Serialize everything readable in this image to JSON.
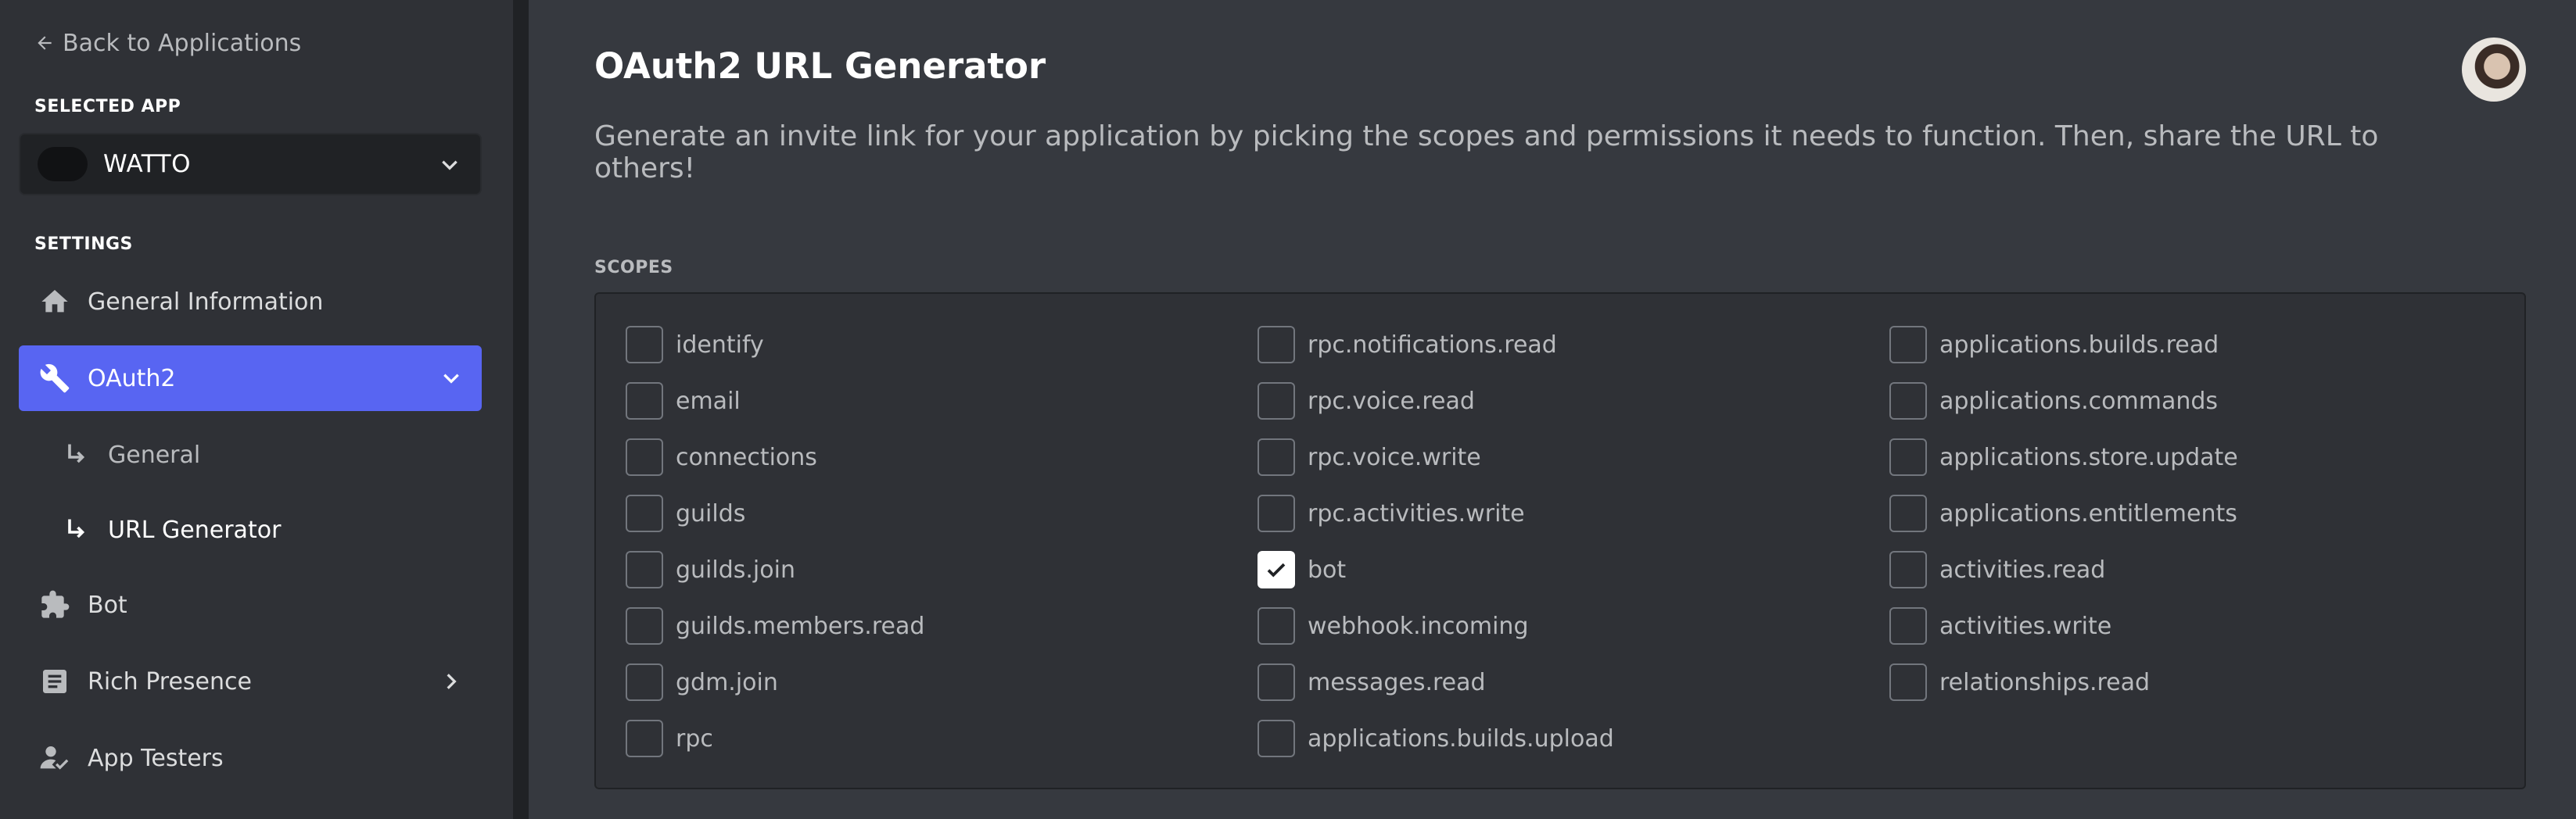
{
  "sidebar": {
    "back_label": "Back to Applications",
    "selected_app_heading": "SELECTED APP",
    "app_name": "WATTO",
    "settings_heading": "SETTINGS",
    "items": {
      "general_information": "General Information",
      "oauth2": "OAuth2",
      "oauth2_general": "General",
      "oauth2_url_generator": "URL Generator",
      "bot": "Bot",
      "rich_presence": "Rich Presence",
      "app_testers": "App Testers"
    },
    "accent_color": "#5865f2"
  },
  "main": {
    "title": "OAuth2 URL Generator",
    "description": "Generate an invite link for your application by picking the scopes and permissions it needs to function. Then, share the URL to others!",
    "scopes_heading": "SCOPES",
    "scopes": {
      "col1": [
        {
          "label": "identify",
          "checked": false
        },
        {
          "label": "email",
          "checked": false
        },
        {
          "label": "connections",
          "checked": false
        },
        {
          "label": "guilds",
          "checked": false
        },
        {
          "label": "guilds.join",
          "checked": false
        },
        {
          "label": "guilds.members.read",
          "checked": false
        },
        {
          "label": "gdm.join",
          "checked": false
        },
        {
          "label": "rpc",
          "checked": false
        }
      ],
      "col2": [
        {
          "label": "rpc.notifications.read",
          "checked": false
        },
        {
          "label": "rpc.voice.read",
          "checked": false
        },
        {
          "label": "rpc.voice.write",
          "checked": false
        },
        {
          "label": "rpc.activities.write",
          "checked": false
        },
        {
          "label": "bot",
          "checked": true
        },
        {
          "label": "webhook.incoming",
          "checked": false
        },
        {
          "label": "messages.read",
          "checked": false
        },
        {
          "label": "applications.builds.upload",
          "checked": false
        }
      ],
      "col3": [
        {
          "label": "applications.builds.read",
          "checked": false
        },
        {
          "label": "applications.commands",
          "checked": false
        },
        {
          "label": "applications.store.update",
          "checked": false
        },
        {
          "label": "applications.entitlements",
          "checked": false
        },
        {
          "label": "activities.read",
          "checked": false
        },
        {
          "label": "activities.write",
          "checked": false
        },
        {
          "label": "relationships.read",
          "checked": false
        }
      ]
    }
  }
}
